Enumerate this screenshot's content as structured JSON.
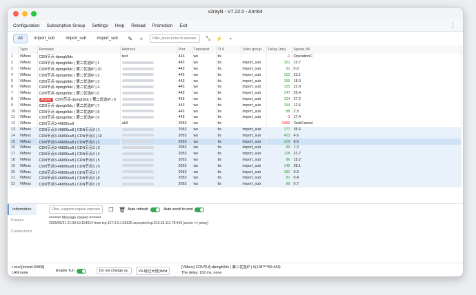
{
  "window": {
    "title": "v2rayN - V7.22.0 - Arm64"
  },
  "menu": {
    "items": [
      "Configuration",
      "Subscription Group",
      "Settings",
      "Help",
      "Reload",
      "Promotion",
      "Exit"
    ]
  },
  "toolbar": {
    "tabs": [
      "All",
      "import_sub",
      "import_sub",
      "import_sub"
    ],
    "filter_placeholder": "Filter, press Enter to execute"
  },
  "table": {
    "headers": [
      "",
      "Type",
      "Remarks",
      "Address",
      "Port",
      "Transport",
      "TLS",
      "Subs group",
      "Delay (ms)",
      "Speed (M"
    ],
    "rows": [
      {
        "n": "1",
        "type": "VMess",
        "remarks": "CDN节点-dpmgh9dc",
        "address": "test",
        "port": "443",
        "transport": "ws",
        "tls": "tls",
        "subs": "",
        "delay": "-1",
        "speed": "OperationC"
      },
      {
        "n": "2",
        "type": "VMess",
        "remarks": "CDN节点-dpmgh9dc | 第二优选IP | 1",
        "address": "",
        "port": "443",
        "transport": "ws",
        "tls": "tls",
        "subs": "import_sub",
        "delay": "161",
        "speed": "13.7"
      },
      {
        "n": "3",
        "type": "VMess",
        "remarks": "CDN节点-dpmgh9dc | 第二优选IP | 10",
        "address": "",
        "port": "443",
        "transport": "ws",
        "tls": "tls",
        "subs": "import_sub",
        "delay": "91",
        "speed": "0.0"
      },
      {
        "n": "4",
        "type": "VMess",
        "remarks": "CDN节点-dpmgh9dc | 第二优选IP | 2",
        "address": "",
        "port": "443",
        "transport": "ws",
        "tls": "tls",
        "subs": "import_sub",
        "delay": "150",
        "speed": "23.1"
      },
      {
        "n": "5",
        "type": "VMess",
        "remarks": "CDN节点-dpmgh9dc | 第二优选IP | 3",
        "address": "",
        "port": "443",
        "transport": "ws",
        "tls": "tls",
        "subs": "import_sub",
        "delay": "155",
        "speed": "18.0"
      },
      {
        "n": "6",
        "type": "VMess",
        "remarks": "CDN节点-dpmgh9dc | 第二优选IP | 4",
        "address": "",
        "port": "443",
        "transport": "ws",
        "tls": "tls",
        "subs": "import_sub",
        "delay": "155",
        "speed": "22.9"
      },
      {
        "n": "7",
        "type": "VMess",
        "remarks": "CDN节点-dpmgh9dc | 第二优选IP | 5",
        "address": "",
        "port": "443",
        "transport": "ws",
        "tls": "tls",
        "subs": "import_sub",
        "delay": "147",
        "speed": "25.4"
      },
      {
        "n": "8",
        "type": "VMess",
        "remarks": "CDN节点-dpmgh9dc | 第二优选IP | 6",
        "address": "",
        "port": "443",
        "transport": "ws",
        "tls": "tls",
        "subs": "import_sub",
        "delay": "134",
        "speed": "27.2",
        "badge": "Active"
      },
      {
        "n": "9",
        "type": "VMess",
        "remarks": "CDN节点-dpmgh9dc | 第二优选IP | 7",
        "address": "",
        "port": "443",
        "transport": "ws",
        "tls": "tls",
        "subs": "import_sub",
        "delay": "154",
        "speed": "12.6"
      },
      {
        "n": "10",
        "type": "VMess",
        "remarks": "CDN节点-dpmgh9dc | 第二优选IP | 8",
        "address": "",
        "port": "443",
        "transport": "ws",
        "tls": "tls",
        "subs": "import_sub",
        "delay": "88",
        "speed": "2.3"
      },
      {
        "n": "11",
        "type": "VMess",
        "remarks": "CDN节点-dpmgh9dc | 第二优选IP | 9",
        "address": "",
        "port": "443",
        "transport": "ws",
        "tls": "tls",
        "subs": "import_sub",
        "delay": "-1",
        "speed": "17.4"
      },
      {
        "n": "12",
        "type": "VMess",
        "remarks": "CDN节点3-46890uv8",
        "address": "ub3",
        "port": "2053",
        "transport": "ws",
        "tls": "tls",
        "subs": "",
        "delay": "1060",
        "speed": "TaskCancel"
      },
      {
        "n": "13",
        "type": "VMess",
        "remarks": "CDN节点3-46890uv8 | CDN节点3 | 1",
        "address": "",
        "port": "2053",
        "transport": "ws",
        "tls": "tls",
        "subs": "import_sub",
        "delay": "177",
        "speed": "35.6"
      },
      {
        "n": "14",
        "type": "VMess",
        "remarks": "CDN节点3-46890uv8 | CDN节点3 | 10",
        "address": "",
        "port": "2053",
        "transport": "ws",
        "tls": "tls",
        "subs": "import_sub",
        "delay": "403",
        "speed": "4.6"
      },
      {
        "n": "15",
        "type": "VMess",
        "remarks": "CDN节点3-46890uv8 | CDN节点3 | 2",
        "address": "",
        "port": "2053",
        "transport": "ws",
        "tls": "tls",
        "subs": "import_sub",
        "delay": "209",
        "speed": "8.6"
      },
      {
        "n": "16",
        "type": "VMess",
        "remarks": "CDN节点3-46890uv8 | CDN节点3 | 3",
        "address": "",
        "port": "2053",
        "transport": "ws",
        "tls": "tls",
        "subs": "import_sub",
        "delay": "89",
        "speed": "1.2"
      },
      {
        "n": "17",
        "type": "VMess",
        "remarks": "CDN节点3-46890uv8 | CDN节点3 | 4",
        "address": "",
        "port": "2053",
        "transport": "ws",
        "tls": "tls",
        "subs": "import_sub",
        "delay": "118",
        "speed": "21.7"
      },
      {
        "n": "18",
        "type": "VMess",
        "remarks": "CDN节点3-46890uv8 | CDN节点3 | 5",
        "address": "",
        "port": "2053",
        "transport": "ws",
        "tls": "tls",
        "subs": "import_sub",
        "delay": "86",
        "speed": "15.2"
      },
      {
        "n": "19",
        "type": "VMess",
        "remarks": "CDN节点3-46890uv8 | CDN节点3 | 6",
        "address": "",
        "port": "2053",
        "transport": "ws",
        "tls": "tls",
        "subs": "import_sub",
        "delay": "148",
        "speed": "28.1"
      },
      {
        "n": "20",
        "type": "VMess",
        "remarks": "CDN节点3-46890uv8 | CDN节点3 | 7",
        "address": "",
        "port": "2053",
        "transport": "ws",
        "tls": "tls",
        "subs": "import_sub",
        "delay": "182",
        "speed": "0.3"
      },
      {
        "n": "21",
        "type": "VMess",
        "remarks": "CDN节点3-46890uv8 | CDN节点3 | 8",
        "address": "",
        "port": "2053",
        "transport": "ws",
        "tls": "tls",
        "subs": "import_sub",
        "delay": "81",
        "speed": "0.4"
      },
      {
        "n": "22",
        "type": "VMess",
        "remarks": "CDN节点3-46890uv8 | CDN节点3 | 9",
        "address": "",
        "port": "2053",
        "transport": "ws",
        "tls": "tls",
        "subs": "import_sub",
        "delay": "88",
        "speed": "0.7"
      }
    ]
  },
  "bottom": {
    "side_items": [
      "Information",
      "Proxies",
      "Connections"
    ],
    "log_filter_placeholder": "Filter, supports regular expressions",
    "auto_refresh_label": "Auto refresh",
    "auto_scroll_label": "Auto scroll to end",
    "log_lines": [
      "====== Message cleared ======",
      "2026/05/21 21:39:19.154014 from tcp:127.0.0.1:56625 accepted tcp:213.35.111.78:443 [socks >> proxy]"
    ]
  },
  "status": {
    "local": "Local:[mixed:10808]",
    "lan": "LAN:none",
    "enable_tun_label": "Enable Tun",
    "sysproxy_select": "Do not change sy:",
    "routing_select": "V4-绕过大陆(Whit",
    "current_server": "[VMess] CDN节点-dpmgh9dc | 第二优选IP | 6(108****82:443)",
    "delay_text": "The delay: 162 ms, none"
  },
  "colors": {
    "accent": "#34a853",
    "active_badge": "#e34b48",
    "selected_row": "#cfe2f6"
  }
}
